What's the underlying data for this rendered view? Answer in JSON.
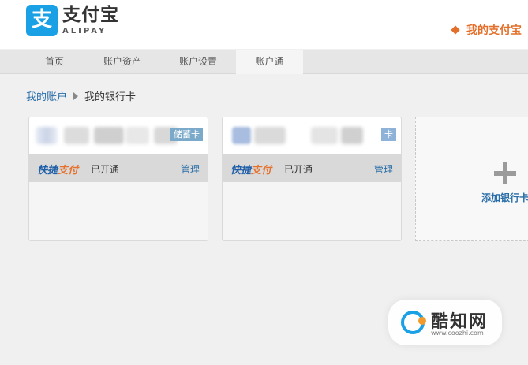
{
  "header": {
    "logo_mark": "支",
    "logo_cn": "支付宝",
    "logo_en": "ALIPAY",
    "my_alipay": "我的支付宝"
  },
  "nav": {
    "items": [
      {
        "label": "首页"
      },
      {
        "label": "账户资产"
      },
      {
        "label": "账户设置"
      },
      {
        "label": "账户通",
        "active": true
      }
    ]
  },
  "breadcrumb": {
    "account": "我的账户",
    "current": "我的银行卡"
  },
  "cards": [
    {
      "tag": "储蓄卡",
      "qp_logo_a": "快捷",
      "qp_logo_b": "支付",
      "status": "已开通",
      "manage": "管理"
    },
    {
      "tag": "卡",
      "qp_logo_a": "快捷",
      "qp_logo_b": "支付",
      "status": "已开通",
      "manage": "管理"
    }
  ],
  "add_card": {
    "label": "添加银行卡"
  },
  "watermark": {
    "cn": "酷知网",
    "url": "www.coozhi.com"
  },
  "colors": {
    "brand_blue": "#1aa1e5",
    "accent_orange": "#e46f2a",
    "link_blue": "#2a6ea8"
  }
}
